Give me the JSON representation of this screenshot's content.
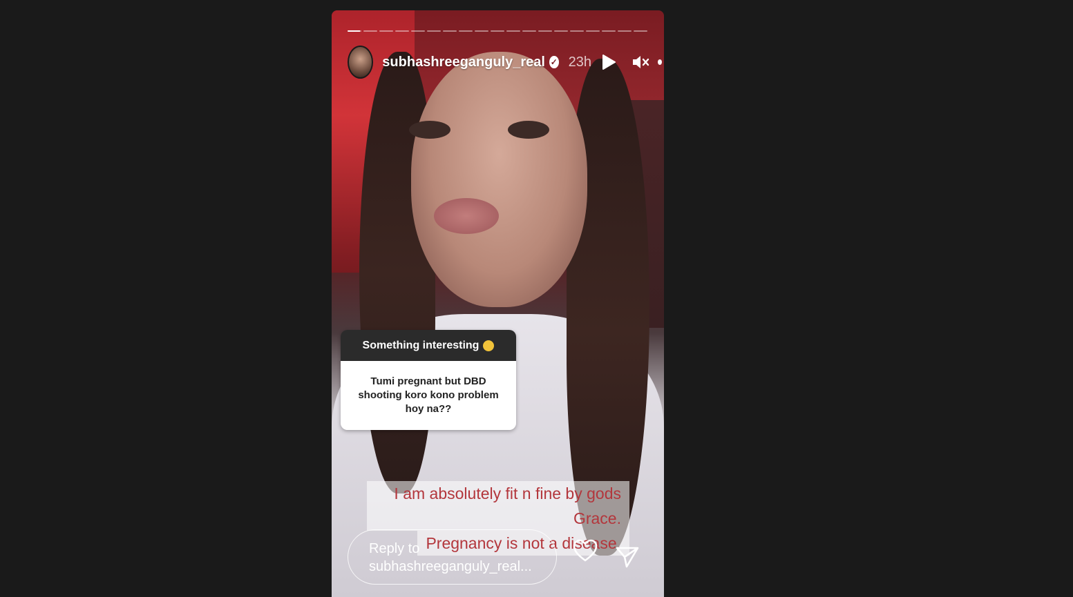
{
  "story": {
    "progress": {
      "segments": 19,
      "active_index": 0,
      "active_fill": 0.9
    },
    "header": {
      "username": "subhashreeganguly_real",
      "verified": true,
      "time": "23h"
    },
    "question": {
      "title": "Something interesting",
      "emoji": "thinking-face",
      "text": "Tumi pregnant but DBD shooting koro kono problem hoy na??"
    },
    "answer": {
      "line1": "I am absolutely fit n fine by gods Grace.",
      "line2": "Pregnancy is not a disease.",
      "color": "#b3363c"
    },
    "reply": {
      "line1": "Reply to",
      "line2": "subhashreeganguly_real..."
    },
    "colors": {
      "background": "#1a1a1a"
    }
  }
}
